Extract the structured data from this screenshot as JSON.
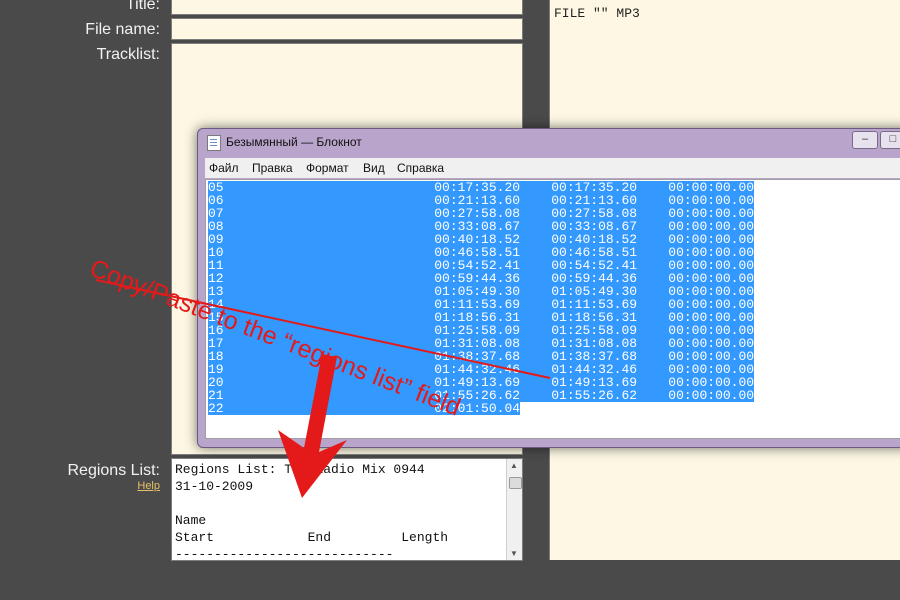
{
  "form": {
    "title_label": "Title:",
    "filename_label": "File name:",
    "tracklist_label": "Tracklist:",
    "regions_label": "Regions List:",
    "help_link": "Help"
  },
  "cue_preview": "FILE \"\" MP3",
  "regions_field": {
    "lines": [
      "Regions List: The Radio Mix 0944",
      "31-10-2009",
      "",
      "Name",
      "Start            End         Length",
      "----------------------------"
    ]
  },
  "notepad": {
    "title": "Безымянный — Блокнот",
    "menu": [
      "Файл",
      "Правка",
      "Формат",
      "Вид",
      "Справка"
    ],
    "menu_underline": [
      "Ф",
      "П",
      "о",
      "В",
      "С"
    ],
    "rows": [
      [
        "05",
        "00:17:35.20",
        "00:17:35.20",
        "00:00:00.00"
      ],
      [
        "06",
        "00:21:13.60",
        "00:21:13.60",
        "00:00:00.00"
      ],
      [
        "07",
        "00:27:58.08",
        "00:27:58.08",
        "00:00:00.00"
      ],
      [
        "08",
        "00:33:08.67",
        "00:33:08.67",
        "00:00:00.00"
      ],
      [
        "09",
        "00:40:18.52",
        "00:40:18.52",
        "00:00:00.00"
      ],
      [
        "10",
        "00:46:58.51",
        "00:46:58.51",
        "00:00:00.00"
      ],
      [
        "11",
        "00:54:52.41",
        "00:54:52.41",
        "00:00:00.00"
      ],
      [
        "12",
        "00:59:44.36",
        "00:59:44.36",
        "00:00:00.00"
      ],
      [
        "13",
        "01:05:49.30",
        "01:05:49.30",
        "00:00:00.00"
      ],
      [
        "14",
        "01:11:53.69",
        "01:11:53.69",
        "00:00:00.00"
      ],
      [
        "15",
        "01:18:56.31",
        "01:18:56.31",
        "00:00:00.00"
      ],
      [
        "16",
        "01:25:58.09",
        "01:25:58.09",
        "00:00:00.00"
      ],
      [
        "17",
        "01:31:08.08",
        "01:31:08.08",
        "00:00:00.00"
      ],
      [
        "18",
        "01:38:37.68",
        "01:38:37.68",
        "00:00:00.00"
      ],
      [
        "19",
        "01:44:32.46",
        "01:44:32.46",
        "00:00:00.00"
      ],
      [
        "20",
        "01:49:13.69",
        "01:49:13.69",
        "00:00:00.00"
      ],
      [
        "21",
        "01:55:26.62",
        "01:55:26.62",
        "00:00:00.00"
      ],
      [
        "22",
        "02:01:50.04"
      ]
    ]
  },
  "annotation": {
    "text": "Copy/Paste to the “regions list” field",
    "color": "#e41a1a"
  },
  "colors": {
    "background": "#4a4a4a",
    "field": "#fdf7e3",
    "selection": "#3399ff"
  }
}
